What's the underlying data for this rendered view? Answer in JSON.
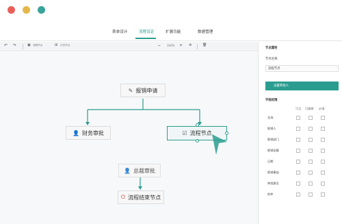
{
  "window": {
    "controls": [
      "red",
      "yellow",
      "teal"
    ]
  },
  "tabs": [
    {
      "label": "表单设计",
      "active": false
    },
    {
      "label": "流程设定",
      "active": true
    },
    {
      "label": "扩展功能",
      "active": false
    },
    {
      "label": "数据管理",
      "active": false
    }
  ],
  "toolbar": {
    "undo_icon": "undo-icon",
    "redo_icon": "redo-icon",
    "add_node_label": "流程节点",
    "add_branch_label": "分支节点",
    "zoom_out": "−",
    "zoom_level": "100%",
    "zoom_in": "+",
    "fit_icon": "target-icon",
    "delete_icon": "trash-icon"
  },
  "flow": {
    "start_node": "报销申请",
    "left_node": "财务审批",
    "right_node": "流程节点",
    "merge_node": "总裁审批",
    "end_node": "流程结束节点"
  },
  "panel": {
    "section_title": "节点属性",
    "name_label": "节点名称",
    "name_value": "流程节点",
    "button_label": "设置审批人",
    "perm_title": "字段权限",
    "col_visible": "可见",
    "col_editable": "可编辑",
    "col_required": "必填",
    "rows": [
      "全选",
      "报销人",
      "报销部门",
      "报销金额",
      "日期",
      "报销事由",
      "审批意见",
      "附件"
    ]
  },
  "colors": {
    "accent": "#2a9d8f"
  }
}
